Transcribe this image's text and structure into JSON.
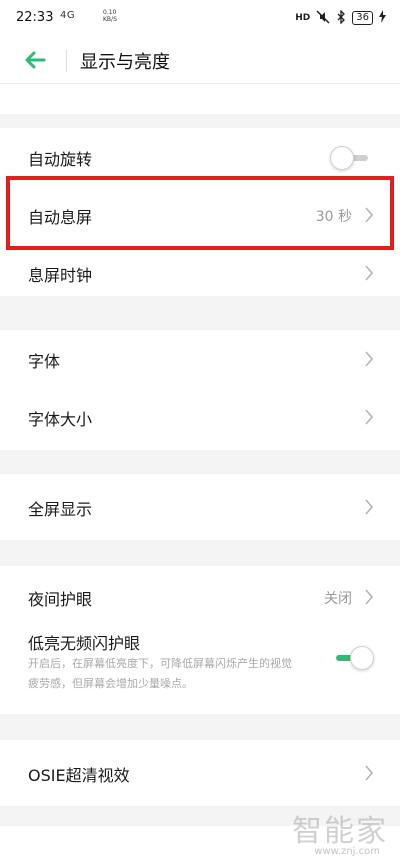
{
  "status_bar": {
    "time": "22:33",
    "network": "4G",
    "speed_value": "0.10",
    "speed_unit": "KB/S",
    "hd": "HD",
    "battery": "36"
  },
  "header": {
    "title": "显示与亮度"
  },
  "rows": {
    "auto_rotate": {
      "label": "自动旋转",
      "toggle": "off"
    },
    "auto_screen_off": {
      "label": "自动息屏",
      "value": "30 秒"
    },
    "aod_clock": {
      "label": "息屏时钟"
    },
    "font": {
      "label": "字体"
    },
    "font_size": {
      "label": "字体大小"
    },
    "full_screen": {
      "label": "全屏显示"
    },
    "night_mode": {
      "label": "夜间护眼",
      "value": "关闭"
    },
    "low_flicker": {
      "label": "低亮无频闪护眼",
      "toggle": "on",
      "description": "开启后，在屏幕低亮度下，可降低屏幕闪烁产生的视觉疲劳感，但屏幕会增加少量噪点。"
    },
    "osie": {
      "label": "OSIE超清视效"
    }
  },
  "watermark": {
    "text": "智能家",
    "url": "www.znj.com"
  },
  "colors": {
    "accent": "#2fbb75",
    "highlight": "#e41d1d",
    "background": "#f4f4f4"
  }
}
